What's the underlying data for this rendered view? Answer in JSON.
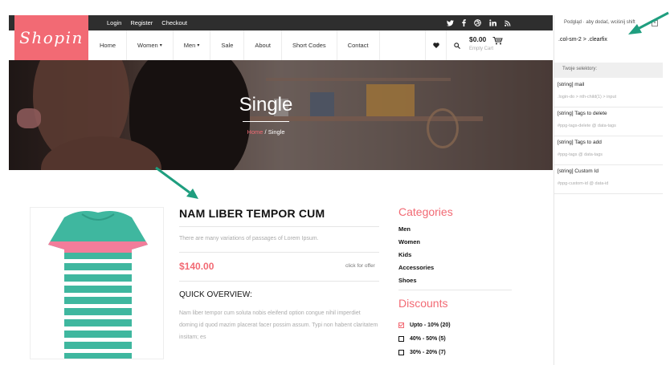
{
  "top_links": [
    "Login",
    "Register",
    "Checkout"
  ],
  "social_icons": [
    "twitter-icon",
    "facebook-icon",
    "dribbble-icon",
    "linkedin-icon",
    "rss-icon"
  ],
  "logo": "Shopin",
  "nav": [
    {
      "label": "Home",
      "dropdown": false
    },
    {
      "label": "Women",
      "dropdown": true
    },
    {
      "label": "Men",
      "dropdown": true
    },
    {
      "label": "Sale",
      "dropdown": false
    },
    {
      "label": "About",
      "dropdown": false
    },
    {
      "label": "Short Codes",
      "dropdown": false
    },
    {
      "label": "Contact",
      "dropdown": false
    }
  ],
  "cart": {
    "total": "$0.00",
    "status": "Empty Cart"
  },
  "banner": {
    "title": "Single",
    "breadcrumb_home": "Home",
    "breadcrumb_sep": " / ",
    "breadcrumb_current": "Single"
  },
  "product": {
    "title": "NAM LIBER TEMPOR CUM",
    "description": "There are many variations of passages of Lorem Ipsum.",
    "price": "$140.00",
    "offer_link": "click for offer",
    "overview_title": "QUICK OVERVIEW:",
    "overview_text": "Nam liber tempor cum soluta nobis eleifend option congue nihil imperdiet doming id quod mazim placerat facer possim assum. Typi non habent claritatem insitam; es"
  },
  "categories": {
    "title": "Categories",
    "items": [
      "Men",
      "Women",
      "Kids",
      "Accessories",
      "Shoes"
    ]
  },
  "discounts": {
    "title": "Discounts",
    "items": [
      {
        "label": "Upto - 10% (20)",
        "checked": true
      },
      {
        "label": "40% - 50% (5)",
        "checked": false
      },
      {
        "label": "30% - 20% (7)",
        "checked": false
      }
    ]
  },
  "panel": {
    "hint": "Podgląd · aby dodać, wciśnij shift",
    "close": "×",
    "selector": ".col-sm-2 > .clearfix",
    "my_selectors": "Twoje selektory:",
    "fields": [
      {
        "name": "[string] mail",
        "path": ".login-do > nth-child(1) > input"
      },
      {
        "name": "[string] Tags to delete",
        "path": "#ppg-tags-delete @ data-tags"
      },
      {
        "name": "[string] Tags to add",
        "path": "#ppg-tags @ data-tags"
      },
      {
        "name": "[string] Custom Id",
        "path": "#ppg-custom-id @ data-id"
      }
    ]
  },
  "colors": {
    "accent": "#f26a74",
    "topbar": "#2e2e2e",
    "annotation": "#1f9e7f"
  }
}
